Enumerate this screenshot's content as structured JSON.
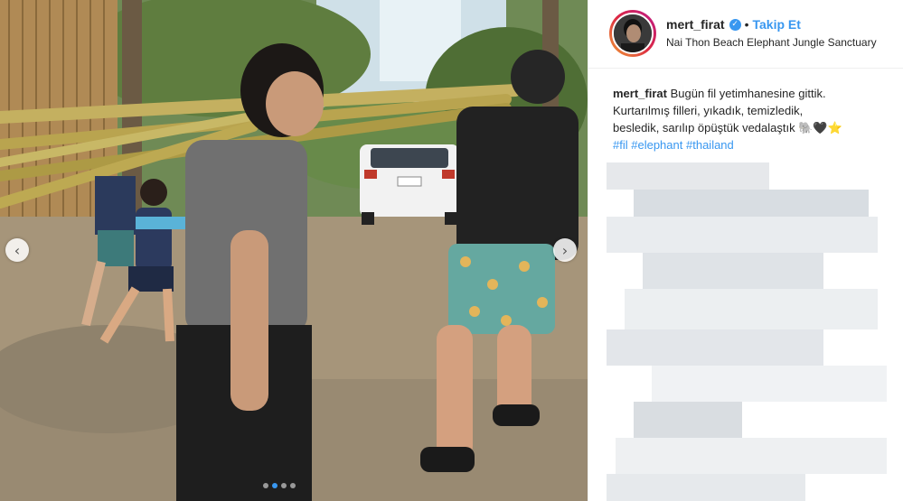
{
  "post": {
    "username": "mert_firat",
    "separator": "•",
    "follow_label": "Takip Et",
    "location": "Nai Thon Beach Elephant Jungle Sanctuary",
    "caption_user": "mert_firat",
    "caption_lines": [
      "Bugün fil yetimhanesine gittik.",
      "Kurtarılmış filleri, yıkadık, temizledik,",
      "besledik, sarılıp öpüştük vedalaştık 🐘🖤⭐"
    ],
    "hashtags": [
      "#fil",
      "#elephant",
      "#thailand"
    ]
  },
  "carousel": {
    "prev_glyph": "‹",
    "next_glyph": "›",
    "dot_count": 4,
    "active_dot": 1
  },
  "colors": {
    "accent": "#3897f0",
    "text": "#262626"
  },
  "icons": [
    "verified-badge-icon",
    "chevron-left-icon",
    "chevron-right-icon"
  ]
}
